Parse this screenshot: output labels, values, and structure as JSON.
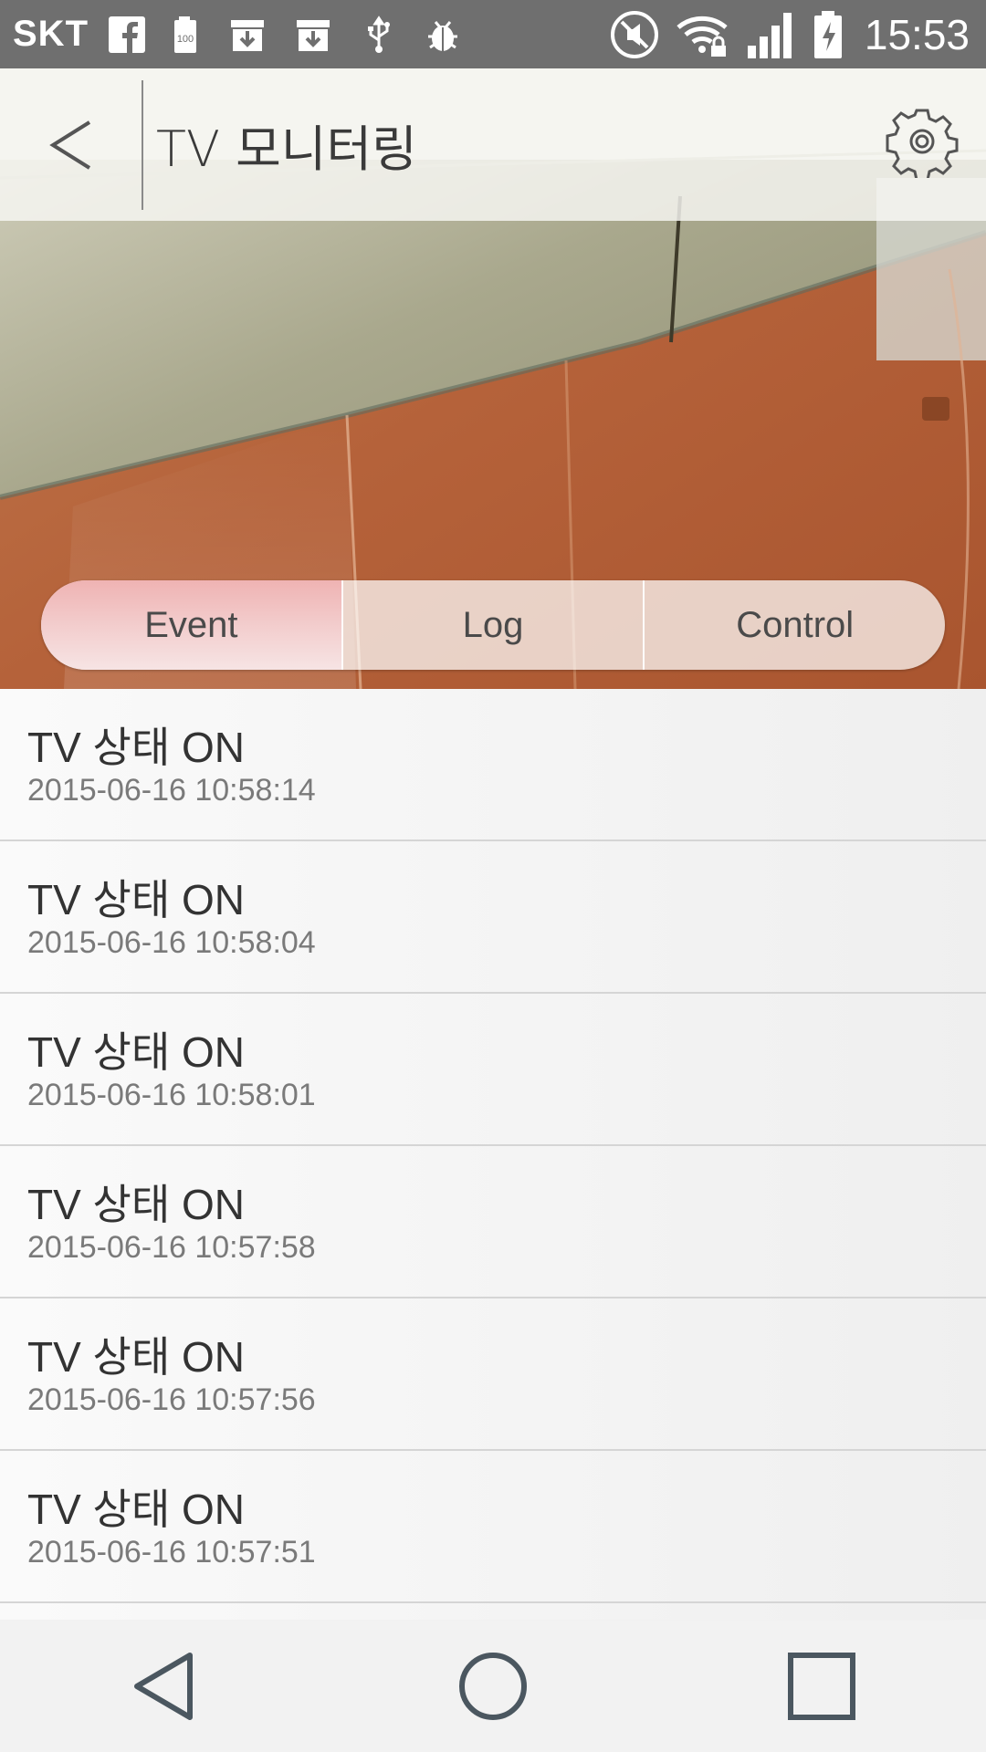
{
  "status_bar": {
    "carrier": "SKT",
    "battery_small_label": "100",
    "time": "15:53",
    "icons": [
      "facebook-icon",
      "battery-100-icon",
      "download-box-icon",
      "download-box-icon",
      "usb-icon",
      "debug-icon",
      "mute-icon",
      "wifi-locked-icon",
      "signal-icon",
      "battery-charging-icon"
    ]
  },
  "header": {
    "title": "TV 모니터링"
  },
  "tabs": [
    {
      "label": "Event",
      "active": true
    },
    {
      "label": "Log",
      "active": false
    },
    {
      "label": "Control",
      "active": false
    }
  ],
  "events": [
    {
      "title": "TV 상태 ON",
      "time": "2015-06-16 10:58:14"
    },
    {
      "title": "TV 상태 ON",
      "time": "2015-06-16 10:58:04"
    },
    {
      "title": "TV 상태 ON",
      "time": "2015-06-16 10:58:01"
    },
    {
      "title": "TV 상태 ON",
      "time": "2015-06-16 10:57:58"
    },
    {
      "title": "TV 상태 ON",
      "time": "2015-06-16 10:57:56"
    },
    {
      "title": "TV 상태 ON",
      "time": "2015-06-16 10:57:51"
    }
  ],
  "colors": {
    "status_bar": "#6f6f6f",
    "active_tab": "#efb3b3",
    "wood_floor": "#b8683c",
    "wall": "#a8a68a"
  }
}
